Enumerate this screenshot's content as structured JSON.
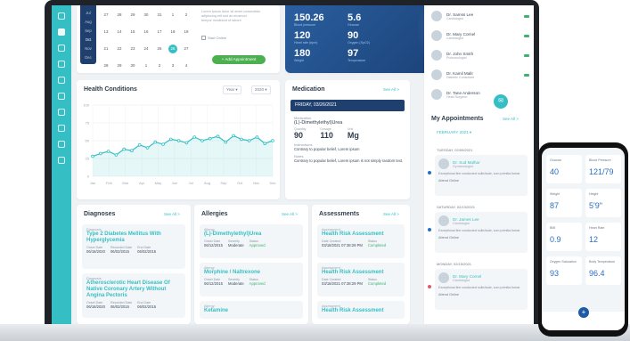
{
  "calendar": {
    "months": [
      "Jul",
      "Aug",
      "Sep",
      "Oct",
      "Nov",
      "Dec"
    ],
    "weeks": [
      [
        "27",
        "28",
        "29",
        "30",
        "31",
        "1",
        "2"
      ],
      [
        "13",
        "14",
        "15",
        "16",
        "17",
        "18",
        "19"
      ],
      [
        "21",
        "22",
        "23",
        "24",
        "25",
        "26",
        "27"
      ],
      [
        "28",
        "29",
        "30",
        "1",
        "2",
        "3",
        "4"
      ]
    ],
    "selected_day": "26",
    "text": [
      "Lorem ipsum dolor sit amet consectetur",
      "adipiscing elit sed do eiusmod",
      "tempor incididunt ut labore"
    ],
    "checkbox_label": "Start Online",
    "add_button": "+ Add Appointment"
  },
  "vitals_banner": {
    "items": [
      {
        "label": "Blood pressure",
        "value": "150.26"
      },
      {
        "label": "Glucose",
        "value": "5.6"
      },
      {
        "label": "Heart rate (bpm)",
        "value": "120"
      },
      {
        "label": "Oxygen (SpO2)",
        "value": "90"
      },
      {
        "label": "Weight",
        "value": "180"
      },
      {
        "label": "Temperature",
        "value": "97"
      }
    ]
  },
  "health_conditions": {
    "title": "Health Conditions",
    "filter1": "Year ▾",
    "filter2": "2020 ▾"
  },
  "chart_data": {
    "type": "area",
    "title": "Health Conditions",
    "categories": [
      "Jan",
      "Feb",
      "Mar",
      "Apr",
      "May",
      "Jun",
      "Jul",
      "Aug",
      "Sep",
      "Oct",
      "Nov",
      "Dec"
    ],
    "y_ticks": [
      "100",
      "75",
      "50",
      "25",
      "0"
    ],
    "ylim": [
      0,
      100
    ],
    "series": [
      {
        "values": [
          28,
          32,
          35,
          30,
          38,
          36,
          44,
          40,
          48,
          45,
          52,
          50,
          47,
          55,
          50,
          53,
          56,
          48,
          57,
          52,
          50,
          55,
          46,
          50
        ]
      }
    ],
    "grid": true
  },
  "medication": {
    "title": "Medication",
    "see_all": "See All >",
    "date": "FRIDAY, 03/26/2021",
    "med_label": "Medication",
    "med_name": "(L)-Dimethylethyl)Urea",
    "cols": [
      {
        "l": "Quantity",
        "v": "90"
      },
      {
        "l": "Dosage",
        "v": "110"
      },
      {
        "l": "Unit",
        "v": "Mg"
      }
    ],
    "inst_label": "Instructions",
    "inst": "Contrary to popular belief, Lorem ipsum",
    "notes_label": "Notes",
    "notes": "Contrary to popular belief, Lorem ipsum is not simply random text."
  },
  "diagnoses": {
    "title": "Diagnoses",
    "see_all": "See All >",
    "items": [
      {
        "label": "Diagnosis",
        "name": "Type 2 Diabetes Mellitus With Hyperglycemia",
        "cols": [
          [
            "Onset Date",
            "06/18/2020"
          ],
          [
            "Recorded Date",
            "06/02/2015"
          ],
          [
            "End Date",
            "06/02/2015"
          ]
        ]
      },
      {
        "label": "Diagnosis",
        "name": "Atherosclerotic Heart Disease Of Native Coronary Artery Without Angina Pectoris",
        "cols": [
          [
            "Onset Date",
            "06/18/2020"
          ],
          [
            "Recorded Date",
            "06/02/2015"
          ],
          [
            "End Date",
            "06/02/2015"
          ]
        ]
      }
    ]
  },
  "allergies": {
    "title": "Allergies",
    "see_all": "See All >",
    "items": [
      {
        "label": "Allergy",
        "name": "(L)-Dimethylethyl)Urea",
        "cols": [
          [
            "Onset Date",
            "06/12/2015"
          ],
          [
            "Severity",
            "Moderate"
          ],
          [
            "Status",
            "Approved"
          ]
        ]
      },
      {
        "label": "Allergy",
        "name": "Morphine / Naltrexone",
        "cols": [
          [
            "Onset Date",
            "06/12/2015"
          ],
          [
            "Severity",
            "Moderate"
          ],
          [
            "Status",
            "Approved"
          ]
        ]
      },
      {
        "label": "Allergy",
        "name": "Ketamine",
        "cols": []
      }
    ]
  },
  "assessments": {
    "title": "Assessments",
    "see_all": "See All >",
    "items": [
      {
        "label": "Assessment",
        "name": "Health Risk Assessment",
        "cols": [
          [
            "Date Created",
            "03/18/2021 07:38:29 PM"
          ],
          [
            "Status",
            "Completed"
          ]
        ]
      },
      {
        "label": "Assessment",
        "name": "Health Risk Assessment",
        "cols": [
          [
            "Date Created",
            "03/18/2021 07:38:29 PM"
          ],
          [
            "Status",
            "Completed"
          ]
        ]
      },
      {
        "label": "Assessment",
        "name": "Health Risk Assessment",
        "cols": []
      }
    ]
  },
  "doctors": [
    {
      "name": "Dr. Samss Lee",
      "spec": "Cardiologist"
    },
    {
      "name": "Dr. Mary Cornel",
      "spec": "Cardiologist"
    },
    {
      "name": "Dr. John Smith",
      "spec": "Pulmonologist"
    },
    {
      "name": "Dr. Kamil Malit",
      "spec": "Diabetic Consultant"
    },
    {
      "name": "Dr. Tane Anderson",
      "spec": "Heart Surgeon"
    }
  ],
  "appointments": {
    "title": "My Appointments",
    "see_all": "See All >",
    "month": "FEBRUARY 2021 ▾",
    "days": [
      {
        "label": "TUESDAY, 02/09/2021",
        "doctor": "Dr. Sud Malhar",
        "spec": "Gynaecologist",
        "desc": "Exceptional fine conducted sollicitude, cum primitia fuerat",
        "link": "Attend Online"
      },
      {
        "label": "SATURDAY, 02/13/2021",
        "doctor": "Dr. James Lee",
        "spec": "Cardiologist",
        "desc": "Exceptional fine conducted sollicitude, cum primitia fuerat",
        "link": "Attend Online"
      },
      {
        "label": "MONDAY, 02/15/2021",
        "doctor": "Dr. Mary Cornel",
        "spec": "Cardiologist",
        "desc": "Exceptional fine conducted sollicitude, cum primitia fuerat",
        "link": "Attend Online"
      }
    ]
  },
  "phone": {
    "vitals": [
      {
        "l": "Glucose",
        "v": "40"
      },
      {
        "l": "Blood Pressure",
        "v": "121/79"
      },
      {
        "l": "Weight",
        "v": "87"
      },
      {
        "l": "Height",
        "v": "5'9\""
      },
      {
        "l": "BMI",
        "v": "0.9"
      },
      {
        "l": "Heart Rate",
        "v": "12"
      },
      {
        "l": "Oxygen Saturation",
        "v": "93"
      },
      {
        "l": "Body Temperature",
        "v": "96.4"
      }
    ],
    "fab": "+"
  }
}
